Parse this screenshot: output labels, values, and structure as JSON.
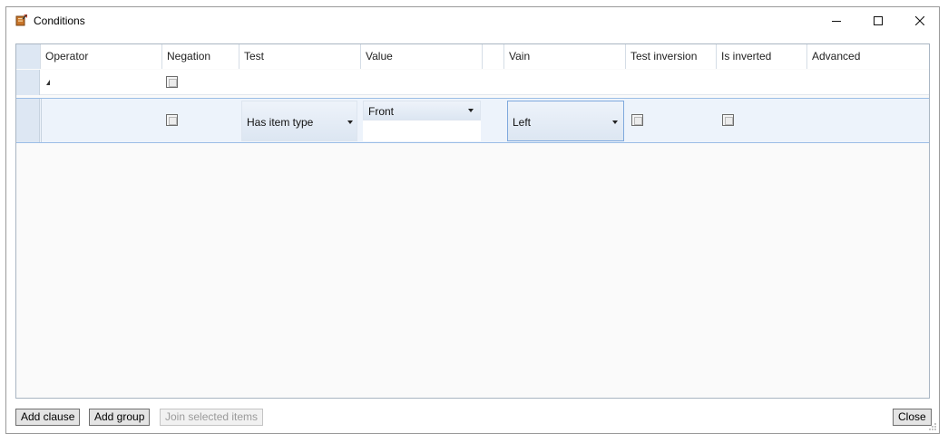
{
  "window": {
    "title": "Conditions",
    "icon": "conditions-app-icon",
    "controls": {
      "minimize": "—",
      "maximize": "☐",
      "close": "✕"
    }
  },
  "grid": {
    "columns": [
      "Operator",
      "Negation",
      "Test",
      "Value",
      "",
      "Vain",
      "Test inversion",
      "Is inverted",
      "Advanced"
    ],
    "group_row": {
      "expanded": true,
      "negation_checked": false
    },
    "clause_row": {
      "negation_checked": false,
      "test": "Has item type",
      "value": "Front",
      "vain": "Left",
      "test_inversion_checked": false,
      "is_inverted_checked": false
    }
  },
  "buttons": {
    "add_clause": "Add clause",
    "add_group": "Add group",
    "join_selected": "Join selected items",
    "close": "Close"
  }
}
